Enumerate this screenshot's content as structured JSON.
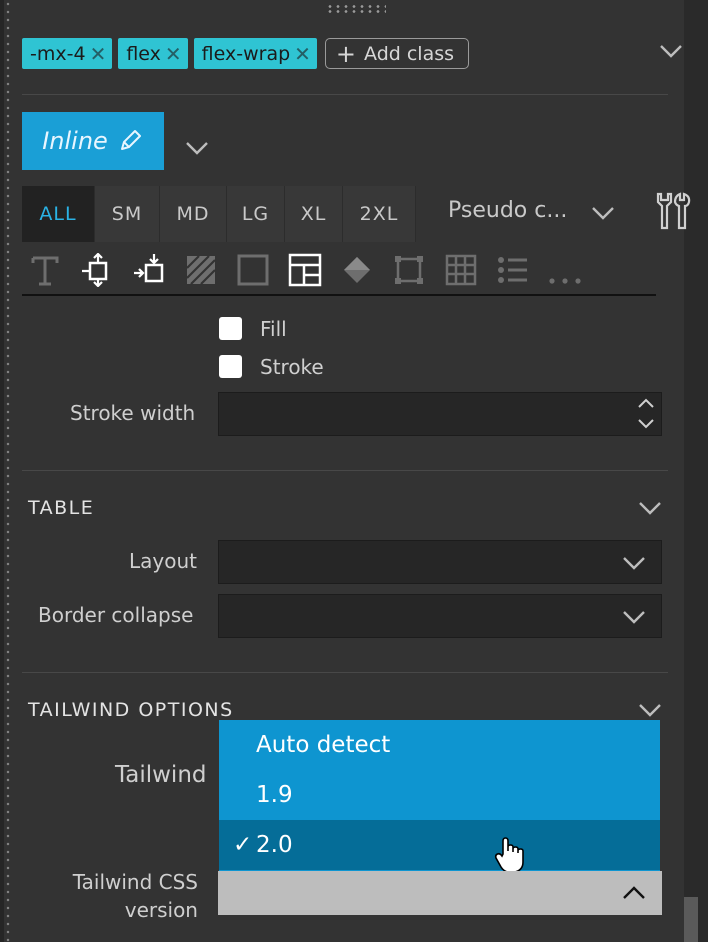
{
  "chips": [
    {
      "label": "-mx-4"
    },
    {
      "label": "flex"
    },
    {
      "label": "flex-wrap"
    }
  ],
  "add_class_label": "Add class",
  "inline_button_label": "Inline",
  "breakpoints": [
    "ALL",
    "SM",
    "MD",
    "LG",
    "XL",
    "2XL"
  ],
  "active_breakpoint": "ALL",
  "pseudo_class_label": "Pseudo c...",
  "svg_section": {
    "fill_label": "Fill",
    "stroke_label": "Stroke",
    "stroke_width_label": "Stroke width",
    "stroke_width_value": ""
  },
  "table_section": {
    "title": "TABLE",
    "layout_label": "Layout",
    "layout_value": "",
    "border_collapse_label": "Border collapse",
    "border_collapse_value": ""
  },
  "tailwind_section": {
    "title": "TAILWIND OPTIONS",
    "partial_label": "Tailwind",
    "version_label_line1": "Tailwind CSS",
    "version_label_line2": "version",
    "options": [
      "Auto detect",
      "1.9",
      "2.0"
    ],
    "selected_option": "2.0",
    "check_mark": "✓"
  },
  "colors": {
    "chip": "#2fc4d3",
    "accent": "#1a9fd6",
    "dropdown": "#0e95d0",
    "dropdown_selected": "#056d98"
  }
}
